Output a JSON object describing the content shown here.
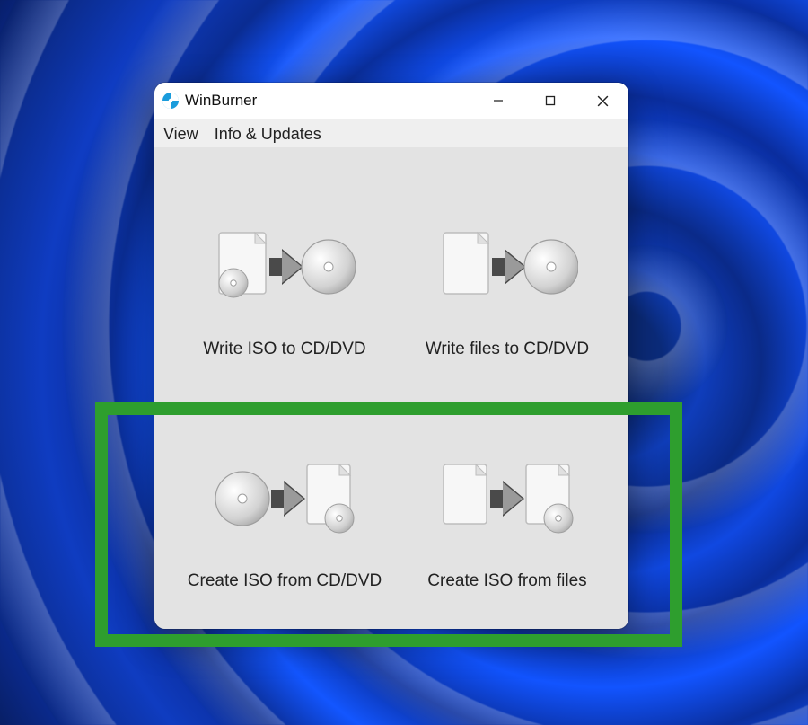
{
  "app": {
    "title": "WinBurner",
    "icon_color": "#1a9cdc"
  },
  "menubar": {
    "items": [
      "View",
      "Info & Updates"
    ]
  },
  "tiles": [
    {
      "label": "Write ISO to CD/DVD"
    },
    {
      "label": "Write files to CD/DVD"
    },
    {
      "label": "Create ISO from CD/DVD"
    },
    {
      "label": "Create ISO from files"
    }
  ],
  "highlight_color": "#2e9e2e"
}
